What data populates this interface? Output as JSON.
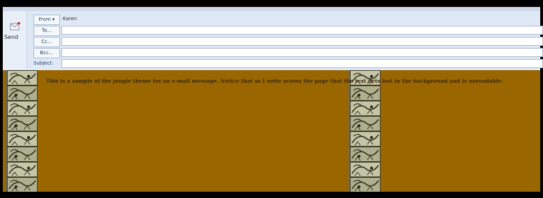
{
  "compose": {
    "send_label": "Send",
    "from_label": "From",
    "from_dropdown": "▾",
    "from_value": "Karen",
    "to_label": "To...",
    "cc_label": "Cc...",
    "bcc_label": "Bcc...",
    "subject_label": "Subject:"
  },
  "message": {
    "text": "This is a sample of the jungle theme for an e-mail message. Notice that as I write across the page that the text gets lost in the background and is unreadable.",
    "background_color": "#9a6600",
    "text_color": "#3b2a10"
  },
  "theme": {
    "ribbon_color": "#dfe8f5",
    "field_border": "#a9b9d0",
    "label_color": "#1e3a5f"
  }
}
